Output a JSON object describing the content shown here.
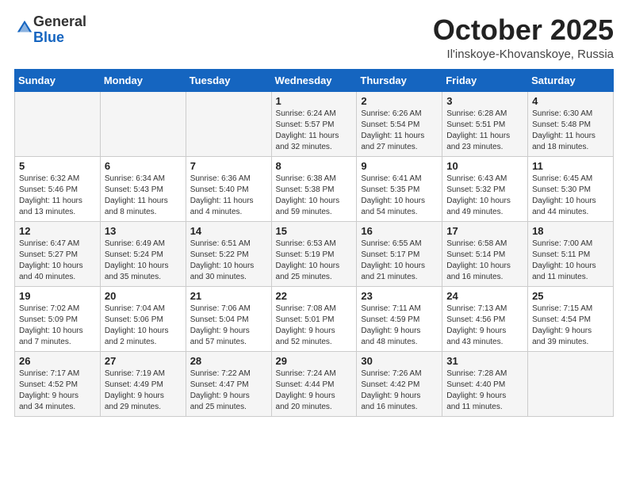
{
  "header": {
    "logo_general": "General",
    "logo_blue": "Blue",
    "month": "October 2025",
    "location": "Il'inskoye-Khovanskoye, Russia"
  },
  "weekdays": [
    "Sunday",
    "Monday",
    "Tuesday",
    "Wednesday",
    "Thursday",
    "Friday",
    "Saturday"
  ],
  "weeks": [
    [
      {
        "day": "",
        "info": ""
      },
      {
        "day": "",
        "info": ""
      },
      {
        "day": "",
        "info": ""
      },
      {
        "day": "1",
        "info": "Sunrise: 6:24 AM\nSunset: 5:57 PM\nDaylight: 11 hours\nand 32 minutes."
      },
      {
        "day": "2",
        "info": "Sunrise: 6:26 AM\nSunset: 5:54 PM\nDaylight: 11 hours\nand 27 minutes."
      },
      {
        "day": "3",
        "info": "Sunrise: 6:28 AM\nSunset: 5:51 PM\nDaylight: 11 hours\nand 23 minutes."
      },
      {
        "day": "4",
        "info": "Sunrise: 6:30 AM\nSunset: 5:48 PM\nDaylight: 11 hours\nand 18 minutes."
      }
    ],
    [
      {
        "day": "5",
        "info": "Sunrise: 6:32 AM\nSunset: 5:46 PM\nDaylight: 11 hours\nand 13 minutes."
      },
      {
        "day": "6",
        "info": "Sunrise: 6:34 AM\nSunset: 5:43 PM\nDaylight: 11 hours\nand 8 minutes."
      },
      {
        "day": "7",
        "info": "Sunrise: 6:36 AM\nSunset: 5:40 PM\nDaylight: 11 hours\nand 4 minutes."
      },
      {
        "day": "8",
        "info": "Sunrise: 6:38 AM\nSunset: 5:38 PM\nDaylight: 10 hours\nand 59 minutes."
      },
      {
        "day": "9",
        "info": "Sunrise: 6:41 AM\nSunset: 5:35 PM\nDaylight: 10 hours\nand 54 minutes."
      },
      {
        "day": "10",
        "info": "Sunrise: 6:43 AM\nSunset: 5:32 PM\nDaylight: 10 hours\nand 49 minutes."
      },
      {
        "day": "11",
        "info": "Sunrise: 6:45 AM\nSunset: 5:30 PM\nDaylight: 10 hours\nand 44 minutes."
      }
    ],
    [
      {
        "day": "12",
        "info": "Sunrise: 6:47 AM\nSunset: 5:27 PM\nDaylight: 10 hours\nand 40 minutes."
      },
      {
        "day": "13",
        "info": "Sunrise: 6:49 AM\nSunset: 5:24 PM\nDaylight: 10 hours\nand 35 minutes."
      },
      {
        "day": "14",
        "info": "Sunrise: 6:51 AM\nSunset: 5:22 PM\nDaylight: 10 hours\nand 30 minutes."
      },
      {
        "day": "15",
        "info": "Sunrise: 6:53 AM\nSunset: 5:19 PM\nDaylight: 10 hours\nand 25 minutes."
      },
      {
        "day": "16",
        "info": "Sunrise: 6:55 AM\nSunset: 5:17 PM\nDaylight: 10 hours\nand 21 minutes."
      },
      {
        "day": "17",
        "info": "Sunrise: 6:58 AM\nSunset: 5:14 PM\nDaylight: 10 hours\nand 16 minutes."
      },
      {
        "day": "18",
        "info": "Sunrise: 7:00 AM\nSunset: 5:11 PM\nDaylight: 10 hours\nand 11 minutes."
      }
    ],
    [
      {
        "day": "19",
        "info": "Sunrise: 7:02 AM\nSunset: 5:09 PM\nDaylight: 10 hours\nand 7 minutes."
      },
      {
        "day": "20",
        "info": "Sunrise: 7:04 AM\nSunset: 5:06 PM\nDaylight: 10 hours\nand 2 minutes."
      },
      {
        "day": "21",
        "info": "Sunrise: 7:06 AM\nSunset: 5:04 PM\nDaylight: 9 hours\nand 57 minutes."
      },
      {
        "day": "22",
        "info": "Sunrise: 7:08 AM\nSunset: 5:01 PM\nDaylight: 9 hours\nand 52 minutes."
      },
      {
        "day": "23",
        "info": "Sunrise: 7:11 AM\nSunset: 4:59 PM\nDaylight: 9 hours\nand 48 minutes."
      },
      {
        "day": "24",
        "info": "Sunrise: 7:13 AM\nSunset: 4:56 PM\nDaylight: 9 hours\nand 43 minutes."
      },
      {
        "day": "25",
        "info": "Sunrise: 7:15 AM\nSunset: 4:54 PM\nDaylight: 9 hours\nand 39 minutes."
      }
    ],
    [
      {
        "day": "26",
        "info": "Sunrise: 7:17 AM\nSunset: 4:52 PM\nDaylight: 9 hours\nand 34 minutes."
      },
      {
        "day": "27",
        "info": "Sunrise: 7:19 AM\nSunset: 4:49 PM\nDaylight: 9 hours\nand 29 minutes."
      },
      {
        "day": "28",
        "info": "Sunrise: 7:22 AM\nSunset: 4:47 PM\nDaylight: 9 hours\nand 25 minutes."
      },
      {
        "day": "29",
        "info": "Sunrise: 7:24 AM\nSunset: 4:44 PM\nDaylight: 9 hours\nand 20 minutes."
      },
      {
        "day": "30",
        "info": "Sunrise: 7:26 AM\nSunset: 4:42 PM\nDaylight: 9 hours\nand 16 minutes."
      },
      {
        "day": "31",
        "info": "Sunrise: 7:28 AM\nSunset: 4:40 PM\nDaylight: 9 hours\nand 11 minutes."
      },
      {
        "day": "",
        "info": ""
      }
    ]
  ]
}
